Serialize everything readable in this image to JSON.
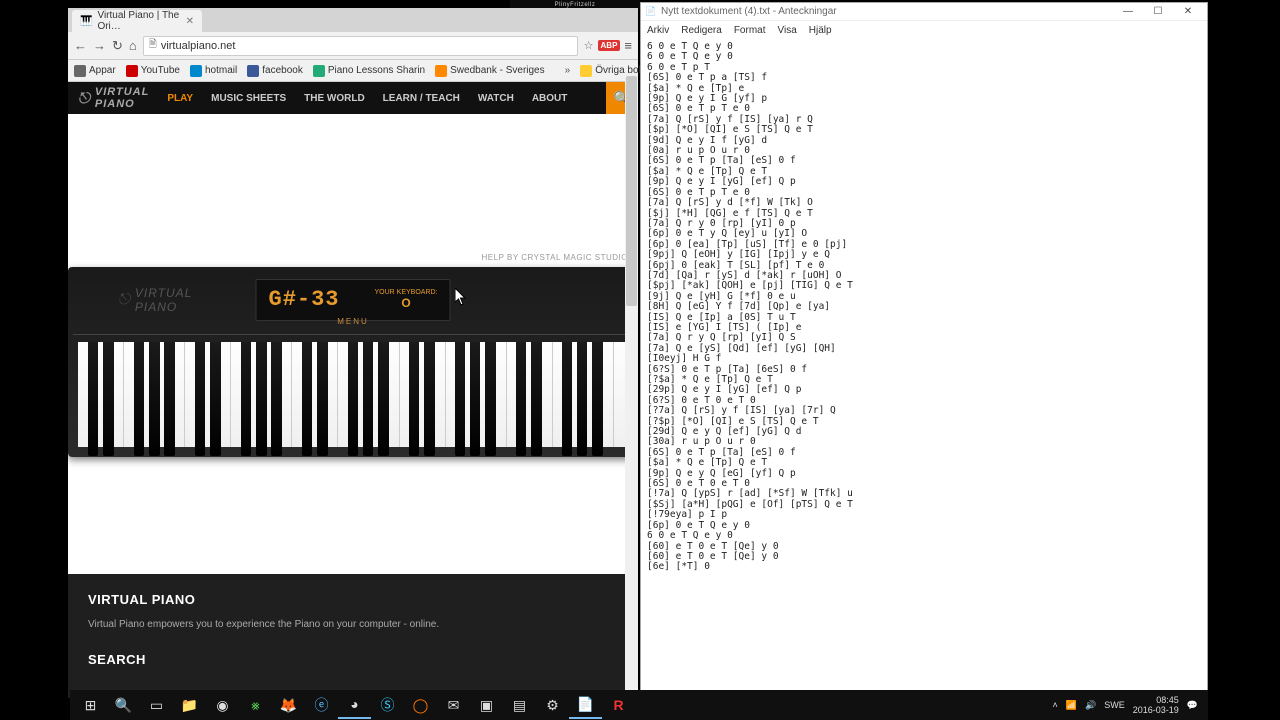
{
  "overlay": {
    "text": "PlinyFritzellz"
  },
  "browser": {
    "tab_title": "Virtual Piano | The Ori…",
    "url": "virtualpiano.net",
    "abp": "ABP",
    "bookmarks": [
      "Appar",
      "YouTube",
      "hotmail",
      "facebook",
      "Piano Lessons Sharin",
      "Swedbank - Sveriges",
      "Övriga bokmärken"
    ]
  },
  "site": {
    "logo_line1": "VIRTUAL",
    "logo_line2": "PIANO",
    "nav": [
      "PLAY",
      "MUSIC SHEETS",
      "THE WORLD",
      "LEARN / TEACH",
      "WATCH",
      "ABOUT"
    ]
  },
  "piano": {
    "credit": "HELP BY CRYSTAL MAGIC STUDIO",
    "current_note": "G#-33",
    "kb_label": "YOUR KEYBOARD:",
    "kb_key": "O",
    "menu_label": "MENU",
    "white_key_count": 36,
    "black_pattern": [
      1,
      1,
      0,
      1,
      1,
      1,
      0
    ]
  },
  "footer": {
    "heading1": "VIRTUAL PIANO",
    "text": "Virtual Piano empowers you to experience the Piano on your computer - online.",
    "heading2": "SEARCH"
  },
  "notepad": {
    "title": "Nytt textdokument (4).txt - Anteckningar",
    "menus": [
      "Arkiv",
      "Redigera",
      "Format",
      "Visa",
      "Hjälp"
    ],
    "content": "6 0 e T Q e y 0\n6 0 e T Q e y 0\n6 0 e T p T\n[6S] 0 e T p a [TS] f\n[$a] * Q e [Tp] e\n[9p] Q e y I G [yf] p\n[6S] 0 e T p T e 0\n[7a] Q [rS] y f [IS] [ya] r Q\n[$p] [*O] [QI] e S [TS] Q e T\n[9d] Q e y I f [yG] d\n[0a] r u p O u r 0\n[6S] 0 e T p [Ta] [eS] 0 f\n[$a] * Q e [Tp] Q e T\n[9p] Q e y I [yG] [ef] Q p\n[6S] 0 e T p T e 0\n[7a] Q [rS] y d [*f] W [Tk] O\n[$j] [*H] [QG] e f [TS] Q e T\n[7a] Q r y 0 [rp] [yI] 0 p\n[6p] 0 e T y Q [ey] u [yI] O\n[6p] 0 [ea] [Tp] [uS] [Tf] e 0 [pj]\n[9pj] Q [eOH] y [IG] [Ipj] y e Q\n[6pj] 0 [eak] T [SL] [pf] T e 0\n[7d] [Qa] r [yS] d [*ak] r [uOH] O\n[$pj] [*ak] [QOH] e [pj] [TIG] Q e T\n[9j] Q e [yH] G [*f] 0 e u\n[8H] Q [eG] Y f [7d] [Qp] e [ya]\n[IS] Q e [Ip] a [0S] T u T\n[IS] e [YG] I [TS] ( [Ip] e\n[7a] Q r y Q [rp] [yI] Q S\n[7a] Q e [yS] [Qd] [ef] [yG] [QH]\n[I0eyj] H G f\n[6?S] 0 e T p [Ta] [6eS] 0 f\n[?$a] * Q e [Tp] Q e T\n[29p] Q e y I [yG] [ef] Q p\n[6?S] 0 e T 0 e T 0\n[?7a] Q [rS] y f [IS] [ya] [7r] Q\n[?$p] [*O] [QI] e S [TS] Q e T\n[29d] Q e y Q [ef] [yG] Q d\n[30a] r u p O u r 0\n[6S] 0 e T p [Ta] [eS] 0 f\n[$a] * Q e [Tp] Q e T\n[9p] Q e y Q [eG] [yf] Q p\n[6S] 0 e T 0 e T 0\n[!7a] Q [ypS] r [ad] [*Sf] W [Tfk] u\n[$Sj] [a*H] [pQG] e [Of] [pTS] Q e T\n[!79eya] p I p\n[6p] 0 e T Q e y 0\n6 0 e T Q e y 0\n[60] e T 0 e T [Qe] y 0\n[60] e T 0 e T [Qe] y 0\n[6e] [*T] 0"
  },
  "taskbar": {
    "lang": "SWE",
    "time": "08:45",
    "date": "2016-03-19"
  }
}
